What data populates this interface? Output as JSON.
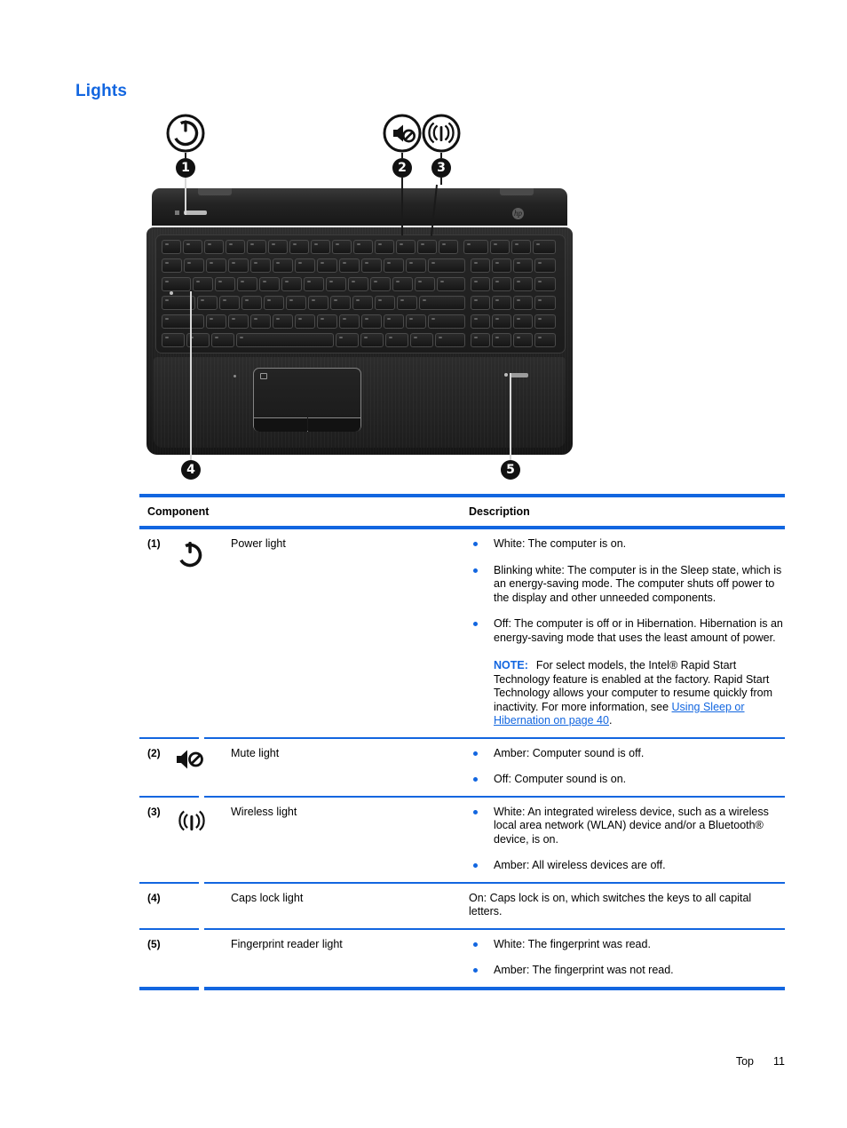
{
  "heading": "Lights",
  "figure": {
    "callouts": [
      {
        "number": "1",
        "icon": "power-icon"
      },
      {
        "number": "2",
        "icon": "mute-icon"
      },
      {
        "number": "3",
        "icon": "wireless-icon"
      },
      {
        "number": "4",
        "icon": "caps-lock-light"
      },
      {
        "number": "5",
        "icon": "fingerprint-reader-light"
      }
    ],
    "device": "hp-laptop-top-view",
    "brand_logo": "hp"
  },
  "table": {
    "headers": {
      "component": "Component",
      "description": "Description"
    },
    "rows": [
      {
        "number": "(1)",
        "icon": "power-icon",
        "label": "Power light",
        "bullets": [
          "White: The computer is on.",
          "Blinking white: The computer is in the Sleep state, which is an energy-saving mode. The computer shuts off power to the display and other unneeded components.",
          "Off: The computer is off or in Hibernation. Hibernation is an energy-saving mode that uses the least amount of power."
        ],
        "note": {
          "label": "NOTE:",
          "text_before": "For select models, the Intel® Rapid Start Technology feature is enabled at the factory. Rapid Start Technology allows your computer to resume quickly from inactivity. For more information, see ",
          "link": "Using Sleep or Hibernation on page 40",
          "text_after": "."
        }
      },
      {
        "number": "(2)",
        "icon": "mute-icon",
        "label": "Mute light",
        "bullets": [
          "Amber: Computer sound is off.",
          "Off: Computer sound is on."
        ]
      },
      {
        "number": "(3)",
        "icon": "wireless-icon",
        "label": "Wireless light",
        "bullets": [
          "White: An integrated wireless device, such as a wireless local area network (WLAN) device and/or a Bluetooth® device, is on.",
          "Amber: All wireless devices are off."
        ]
      },
      {
        "number": "(4)",
        "icon": "",
        "label": "Caps lock light",
        "plain": "On: Caps lock is on, which switches the keys to all capital letters."
      },
      {
        "number": "(5)",
        "icon": "",
        "label": "Fingerprint reader light",
        "bullets": [
          "White: The fingerprint was read.",
          "Amber: The fingerprint was not read."
        ]
      }
    ]
  },
  "footer": {
    "section": "Top",
    "page": "11"
  },
  "colors": {
    "accent_blue": "#1266e0",
    "text": "#000000",
    "page_background": "#ffffff"
  }
}
